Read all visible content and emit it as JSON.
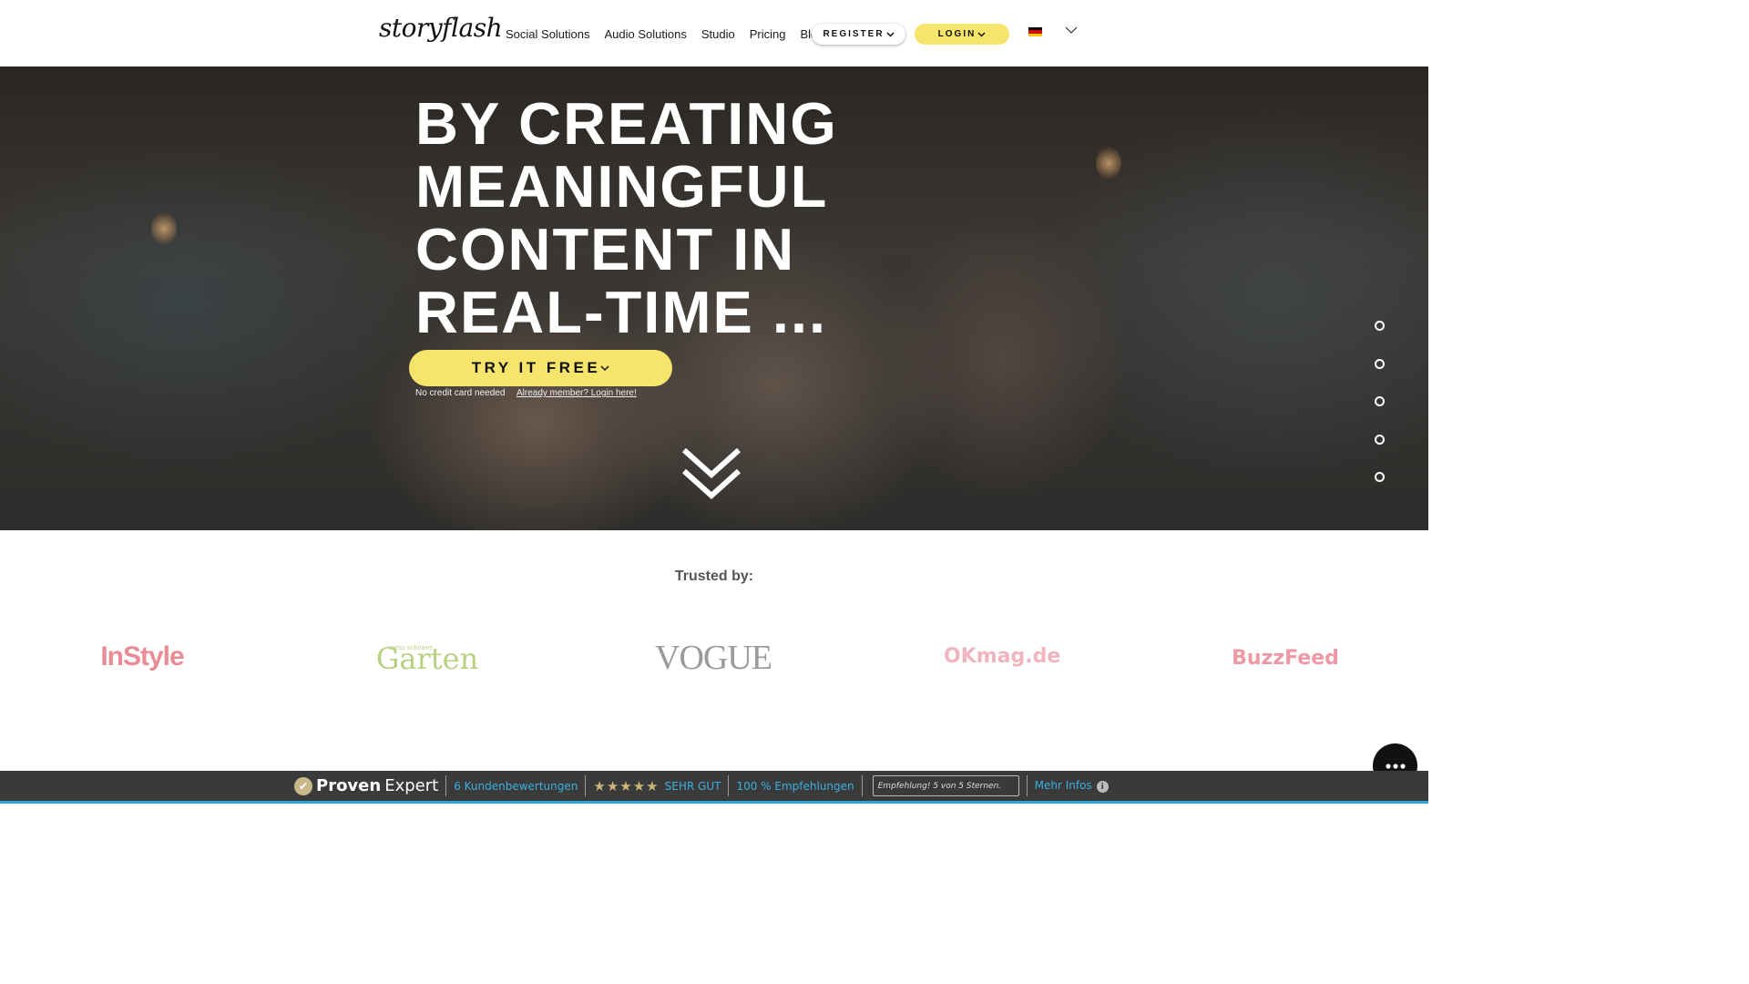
{
  "header": {
    "logo": "storyflash",
    "nav": [
      "Social Solutions",
      "Audio Solutions",
      "Studio",
      "Pricing",
      "Blog"
    ],
    "register_label": "REGISTER",
    "login_label": "LOGIN",
    "language_flag": "german-flag"
  },
  "hero": {
    "headline": "BY CREATING MEANINGFUL CONTENT IN REAL-TIME ...",
    "cta_label": "TRY IT FREE",
    "note": "No credit card needed",
    "login_link": "Already member? Login here!",
    "section_dots": 5
  },
  "trusted": {
    "title": "Trusted by:",
    "brands": [
      "InStyle",
      "Garten",
      "VOGUE",
      "OKmag.de",
      "BuzzFeed"
    ],
    "garten_tagline": "mein schöner"
  },
  "proven_expert": {
    "brand_bold": "Proven",
    "brand_light": "Expert",
    "reviews": "6 Kundenbewertungen",
    "stars": "★★★★★",
    "rating": "SEHR GUT",
    "recommendations": "100 % Empfehlungen",
    "quote": "Empfehlung! 5 von 5 Sternen.",
    "more_info": "Mehr Infos"
  },
  "colors": {
    "accent_yellow": "#f7e46b",
    "pe_blue": "#3aaee0",
    "pe_bar": "#3a3a3a"
  }
}
